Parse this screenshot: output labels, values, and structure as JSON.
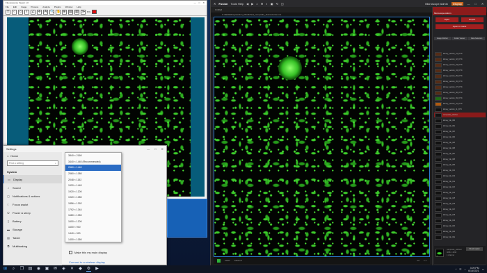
{
  "viewer": {
    "title": "Fluorescence Viewer 1.0",
    "menu": [
      "File",
      "Edit",
      "Image",
      "Process",
      "Analyze",
      "Plugins",
      "Window",
      "Help"
    ],
    "toolbar": [
      "□",
      "○",
      "◇",
      "⌇",
      "∠",
      "✛",
      "A",
      "🔍",
      "✋",
      "⊕",
      "▤",
      "▥",
      "≫"
    ],
    "toolbar_label": "R/G",
    "accent": "#e01010"
  },
  "fusion": {
    "brand": "Fusion",
    "menu_text": "Tools  Help",
    "nav_icons": [
      "◀",
      "▶",
      "⌂",
      "⚙",
      "◐",
      "▣",
      "⟲",
      "◫"
    ],
    "user_label": "Microscope Admin",
    "alert_label": "Display",
    "window_controls": [
      "—",
      "□",
      "✕"
    ],
    "subbar_text": "Untitled",
    "path": "C:\\data\\kidney\\section_03\\stitched_composite_fluorescence.ims",
    "path_meta": "4096 × 4096 px",
    "status_left": "100%",
    "status_center": "Stitched",
    "status_right": [
      "Fit",
      "1:1"
    ],
    "accent": "#2f7fd6"
  },
  "fusion_panel": {
    "header": "Microscope Admin",
    "buttons": [
      "Open",
      "Export"
    ],
    "wide_button": "Open in Imaris",
    "tabs": [
      "Image Stitcher",
      "Folder Viewer",
      "Data Selection"
    ],
    "files": [
      {
        "label": "kidney_section_01_FITC",
        "thumb": "brown"
      },
      {
        "label": "kidney_section_02_FITC",
        "thumb": "brown"
      },
      {
        "label": "kidney_section_03_FITC",
        "thumb": "brown"
      },
      {
        "label": "kidney_section_04_FITC",
        "thumb": "brown"
      },
      {
        "label": "kidney_section_05_FITC",
        "thumb": "brown"
      },
      {
        "label": "kidney_section_06_FITC",
        "thumb": "brown"
      },
      {
        "label": "kidney_section_07_FITC",
        "thumb": "brown"
      },
      {
        "label": "kidney_section_08_FITC",
        "thumb": "brown"
      },
      {
        "label": "kidney_section_09_FITC",
        "thumb": "green"
      },
      {
        "label": "kidney_section_10_FITC",
        "thumb": "orange"
      },
      {
        "label": "kidney_section_11_FITC",
        "thumb": "black"
      },
      {
        "label": "composite_stitched",
        "thumb": "black",
        "selected": true
      },
      {
        "label": "kidney_tile_001",
        "thumb": "black"
      },
      {
        "label": "kidney_tile_002",
        "thumb": "black"
      },
      {
        "label": "kidney_tile_003",
        "thumb": "black"
      },
      {
        "label": "kidney_tile_004",
        "thumb": "black"
      },
      {
        "label": "kidney_tile_005",
        "thumb": "black"
      },
      {
        "label": "kidney_tile_006",
        "thumb": "black"
      },
      {
        "label": "kidney_tile_007",
        "thumb": "black"
      },
      {
        "label": "kidney_tile_008",
        "thumb": "black"
      },
      {
        "label": "kidney_tile_009",
        "thumb": "black"
      },
      {
        "label": "kidney_tile_010",
        "thumb": "black"
      },
      {
        "label": "kidney_tile_011",
        "thumb": "black"
      },
      {
        "label": "kidney_tile_012",
        "thumb": "black"
      },
      {
        "label": "kidney_tile_013",
        "thumb": "black"
      },
      {
        "label": "kidney_tile_014",
        "thumb": "black"
      },
      {
        "label": "kidney_tile_015",
        "thumb": "black"
      },
      {
        "label": "kidney_tile_016",
        "thumb": "black"
      },
      {
        "label": "kidney_tile_017",
        "thumb": "black"
      },
      {
        "label": "kidney_tile_018",
        "thumb": "black"
      },
      {
        "label": "kidney_tile_019",
        "thumb": "black"
      },
      {
        "label": "kidney_tile_020",
        "thumb": "black"
      },
      {
        "label": "kidney_tile_021",
        "thumb": "black"
      },
      {
        "label": "kidney_tile_022",
        "thumb": "black"
      }
    ],
    "bottom_button": "Reset Layout",
    "bottom_info": [
      "composite_stitched",
      "4096 × 4096",
      "1 channel"
    ]
  },
  "settings": {
    "title": "Settings",
    "window_controls": [
      "—",
      "□",
      "✕"
    ],
    "home": "Home",
    "search_placeholder": "Find a setting",
    "section": "System",
    "nav_items": [
      {
        "label": "Display",
        "icon": "▭",
        "active": true
      },
      {
        "label": "Sound",
        "icon": "♪"
      },
      {
        "label": "Notifications & actions",
        "icon": "▢"
      },
      {
        "label": "Focus assist",
        "icon": "☾"
      },
      {
        "label": "Power & sleep",
        "icon": "⏻"
      },
      {
        "label": "Battery",
        "icon": "▯"
      },
      {
        "label": "Storage",
        "icon": "▬"
      },
      {
        "label": "Tablet",
        "icon": "▤"
      },
      {
        "label": "Multitasking",
        "icon": "⧉"
      }
    ],
    "checkbox_label": "Make this my main display",
    "link": "Connect to a wireless display"
  },
  "resolution_dropdown": {
    "options": [
      "3840 × 2160",
      "3440 × 1440 (Recommended)",
      "2560 × 1440",
      "2560 × 1080",
      "2048 × 1152",
      "1920 × 1440",
      "1920 × 1200",
      "1920 × 1080",
      "1856 × 1392",
      "1792 × 1344",
      "1680 × 1050",
      "1600 × 1200",
      "1600 × 900",
      "1440 × 900",
      "1400 × 1050"
    ],
    "selected_index": 2,
    "accent": "#2b6cc4"
  },
  "taskbar": {
    "icons": [
      {
        "name": "windows-start-icon",
        "glyph": "⊞"
      },
      {
        "name": "search-icon",
        "glyph": "⌕"
      },
      {
        "name": "task-view-icon",
        "glyph": "❐"
      },
      {
        "name": "file-explorer-icon",
        "glyph": "▤"
      },
      {
        "name": "edge-icon",
        "glyph": "◉"
      },
      {
        "name": "store-icon",
        "glyph": "▣"
      },
      {
        "name": "mail-icon",
        "glyph": "✉"
      },
      {
        "name": "viewer-app-icon",
        "glyph": "◈"
      },
      {
        "name": "fusion-app-icon",
        "glyph": "✕"
      },
      {
        "name": "imaris-icon",
        "glyph": "◆"
      },
      {
        "name": "settings-icon",
        "glyph": "⚙"
      },
      {
        "name": "terminal-icon",
        "glyph": "▶"
      }
    ],
    "active_index": 10,
    "time": "3:09 PM",
    "date": "6/16/2021"
  }
}
